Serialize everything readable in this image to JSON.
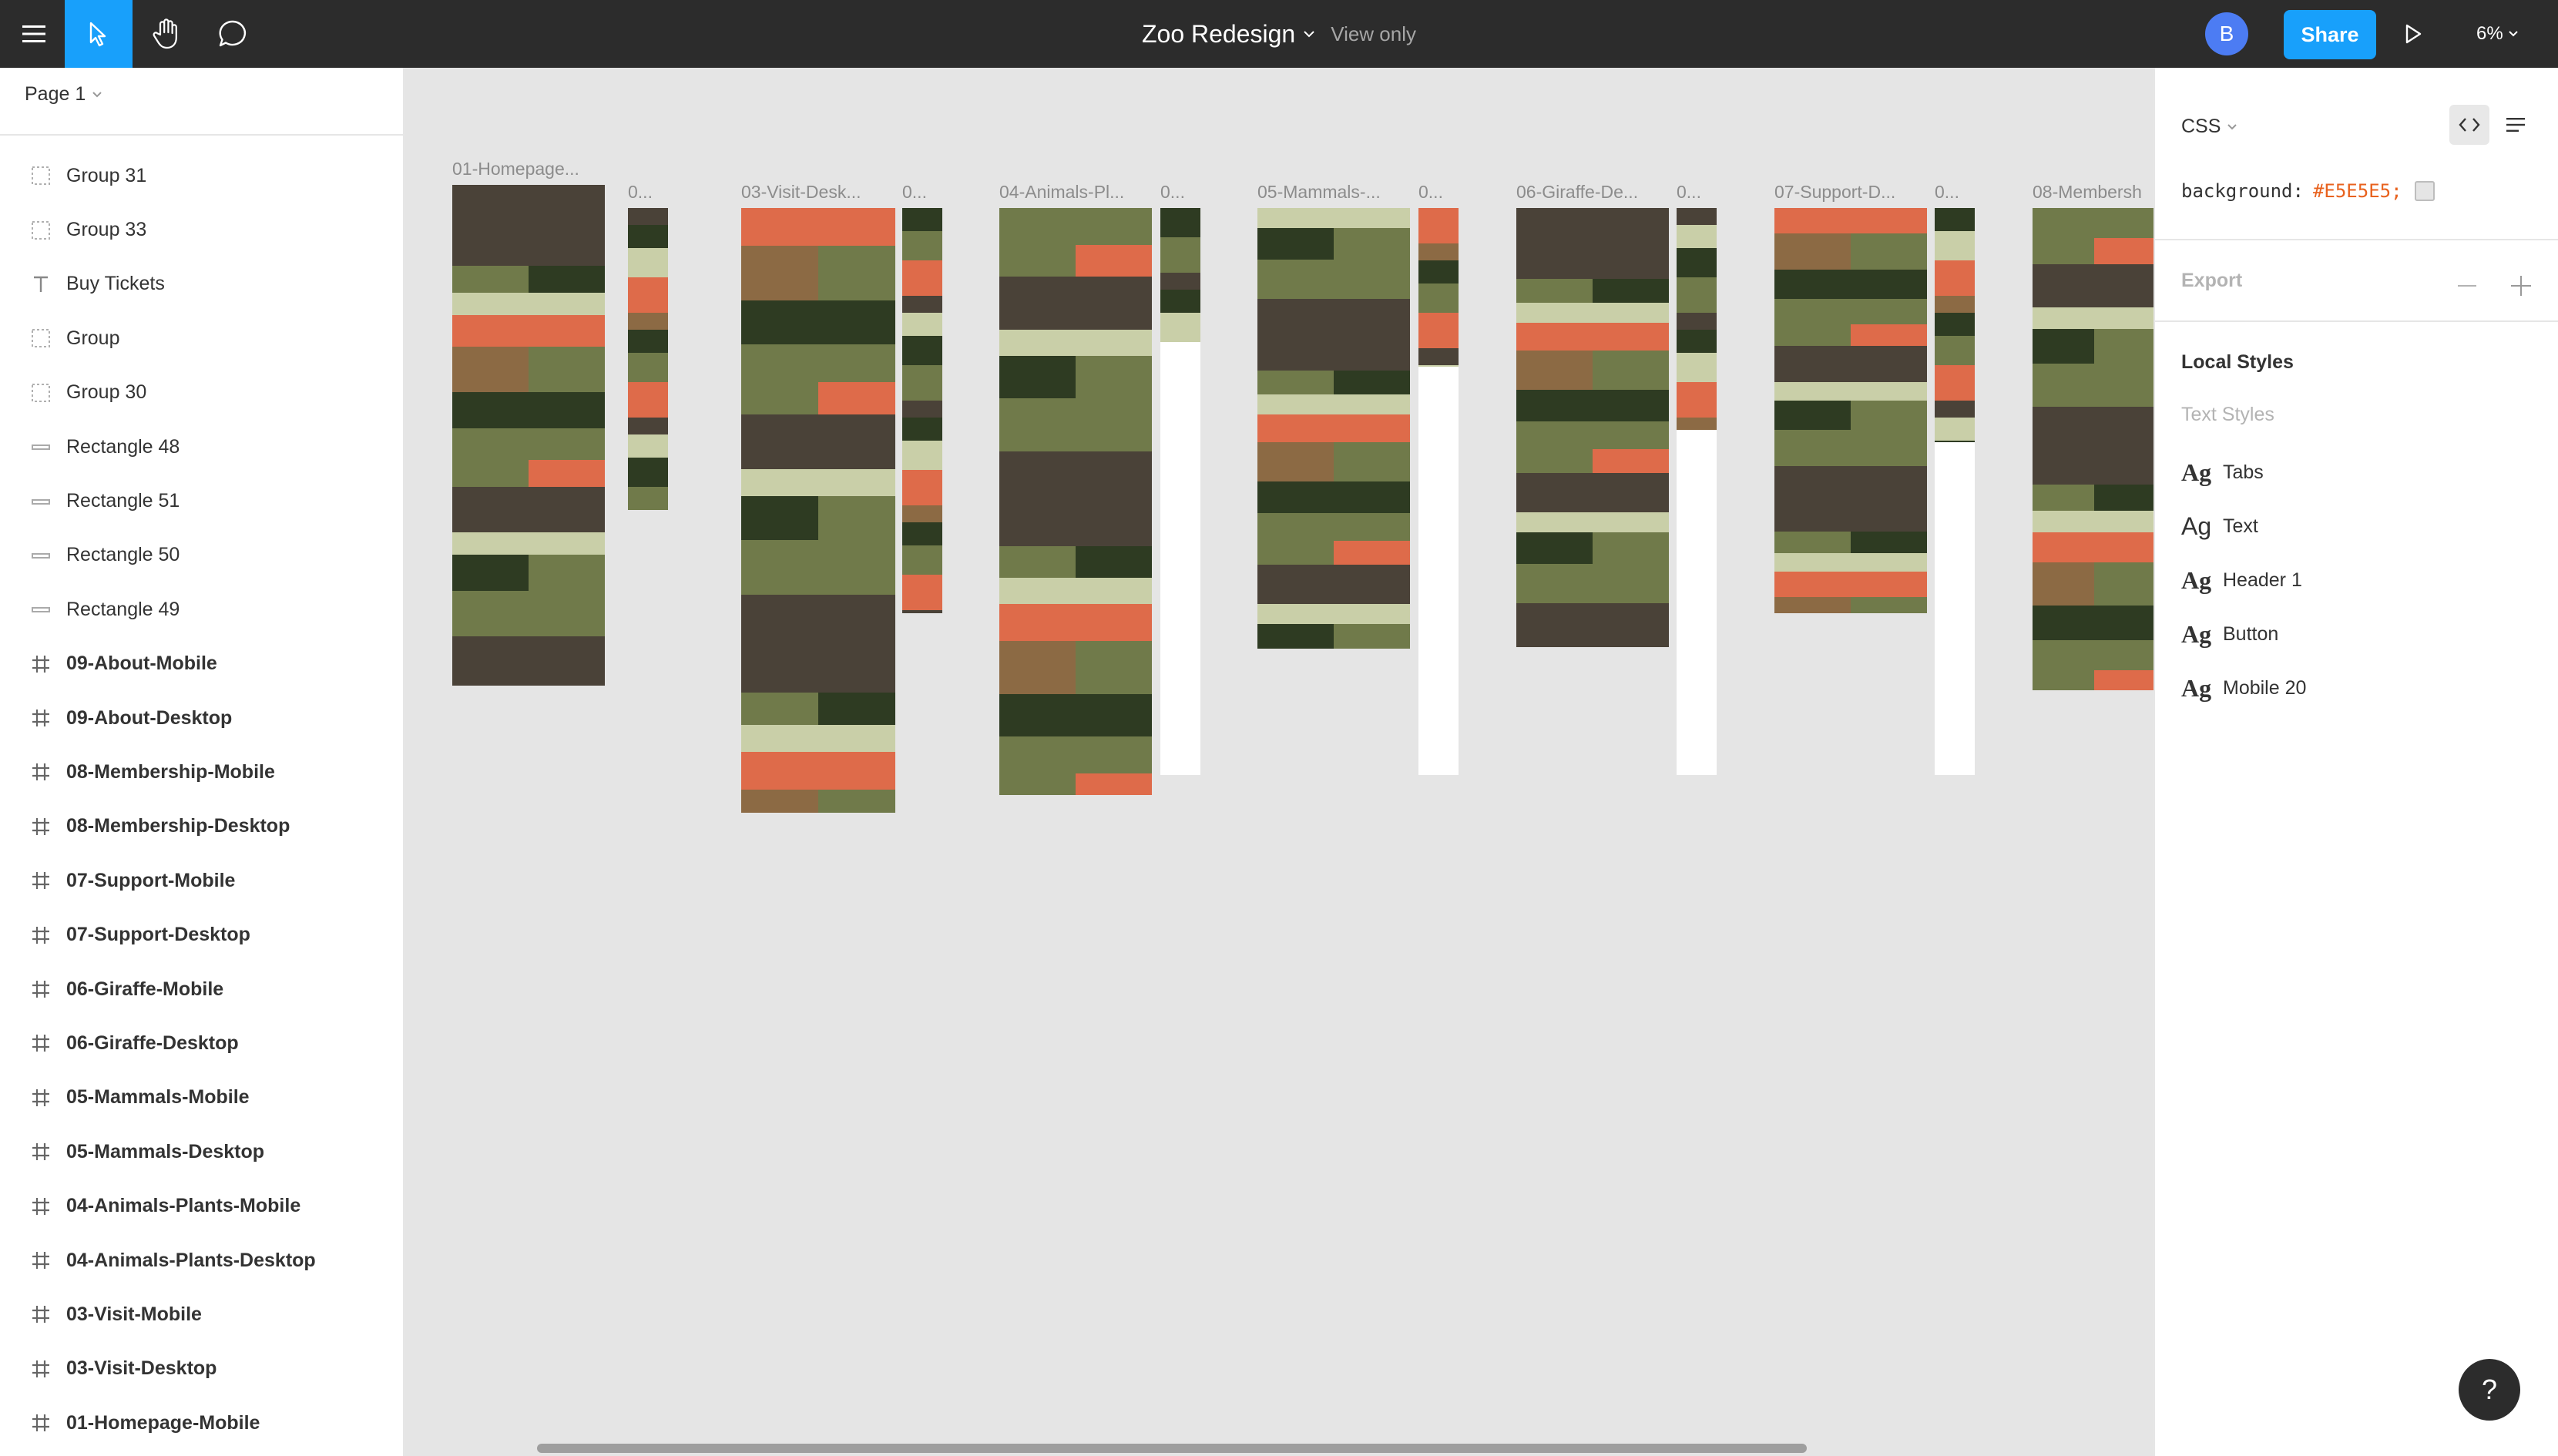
{
  "topbar": {
    "file_title": "Zoo Redesign",
    "view_mode": "View only",
    "avatar_initial": "B",
    "share_label": "Share",
    "zoom_level": "6%"
  },
  "left_panel": {
    "page_name": "Page 1",
    "layers": [
      {
        "label": "Group 31",
        "type": "group"
      },
      {
        "label": "Group 33",
        "type": "group"
      },
      {
        "label": "Buy Tickets",
        "type": "text"
      },
      {
        "label": "Group",
        "type": "group"
      },
      {
        "label": "Group 30",
        "type": "group"
      },
      {
        "label": "Rectangle 48",
        "type": "rectangle"
      },
      {
        "label": "Rectangle 51",
        "type": "rectangle"
      },
      {
        "label": "Rectangle 50",
        "type": "rectangle"
      },
      {
        "label": "Rectangle 49",
        "type": "rectangle"
      },
      {
        "label": "09-About-Mobile",
        "type": "frame"
      },
      {
        "label": "09-About-Desktop",
        "type": "frame"
      },
      {
        "label": "08-Membership-Mobile",
        "type": "frame"
      },
      {
        "label": "08-Membership-Desktop",
        "type": "frame"
      },
      {
        "label": "07-Support-Mobile",
        "type": "frame"
      },
      {
        "label": "07-Support-Desktop",
        "type": "frame"
      },
      {
        "label": "06-Giraffe-Mobile",
        "type": "frame"
      },
      {
        "label": "06-Giraffe-Desktop",
        "type": "frame"
      },
      {
        "label": "05-Mammals-Mobile",
        "type": "frame"
      },
      {
        "label": "05-Mammals-Desktop",
        "type": "frame"
      },
      {
        "label": "04-Animals-Plants-Mobile",
        "type": "frame"
      },
      {
        "label": "04-Animals-Plants-Desktop",
        "type": "frame"
      },
      {
        "label": "03-Visit-Mobile",
        "type": "frame"
      },
      {
        "label": "03-Visit-Desktop",
        "type": "frame"
      },
      {
        "label": "01-Homepage-Mobile",
        "type": "frame"
      }
    ]
  },
  "canvas": {
    "frames": [
      {
        "desktop_label": "01-Homepage...",
        "mobile_label": "0..."
      },
      {
        "desktop_label": "03-Visit-Desk...",
        "mobile_label": "0..."
      },
      {
        "desktop_label": "04-Animals-Pl...",
        "mobile_label": "0..."
      },
      {
        "desktop_label": "05-Mammals-...",
        "mobile_label": "0..."
      },
      {
        "desktop_label": "06-Giraffe-De...",
        "mobile_label": "0..."
      },
      {
        "desktop_label": "07-Support-D...",
        "mobile_label": "0..."
      },
      {
        "desktop_label": "08-Membersh",
        "mobile_label": ""
      }
    ],
    "palette": {
      "dark_green": "#2e3b22",
      "olive": "#707a4a",
      "sage": "#c9cfa8",
      "orange": "#de6b4a",
      "photo_dark": "#4a4238",
      "photo_warm": "#8c6a44"
    }
  },
  "right_panel": {
    "tab_label": "CSS",
    "css_property": "background:",
    "css_value": "#E5E5E5;",
    "export_label": "Export",
    "local_styles_heading": "Local Styles",
    "text_styles_heading": "Text Styles",
    "text_styles": [
      {
        "glyph": "Ag",
        "name": "Tabs"
      },
      {
        "glyph": "Ag",
        "name": "Text"
      },
      {
        "glyph": "Ag",
        "name": "Header 1"
      },
      {
        "glyph": "Ag",
        "name": "Button"
      },
      {
        "glyph": "Ag",
        "name": "Mobile 20"
      }
    ]
  },
  "help_label": "?"
}
